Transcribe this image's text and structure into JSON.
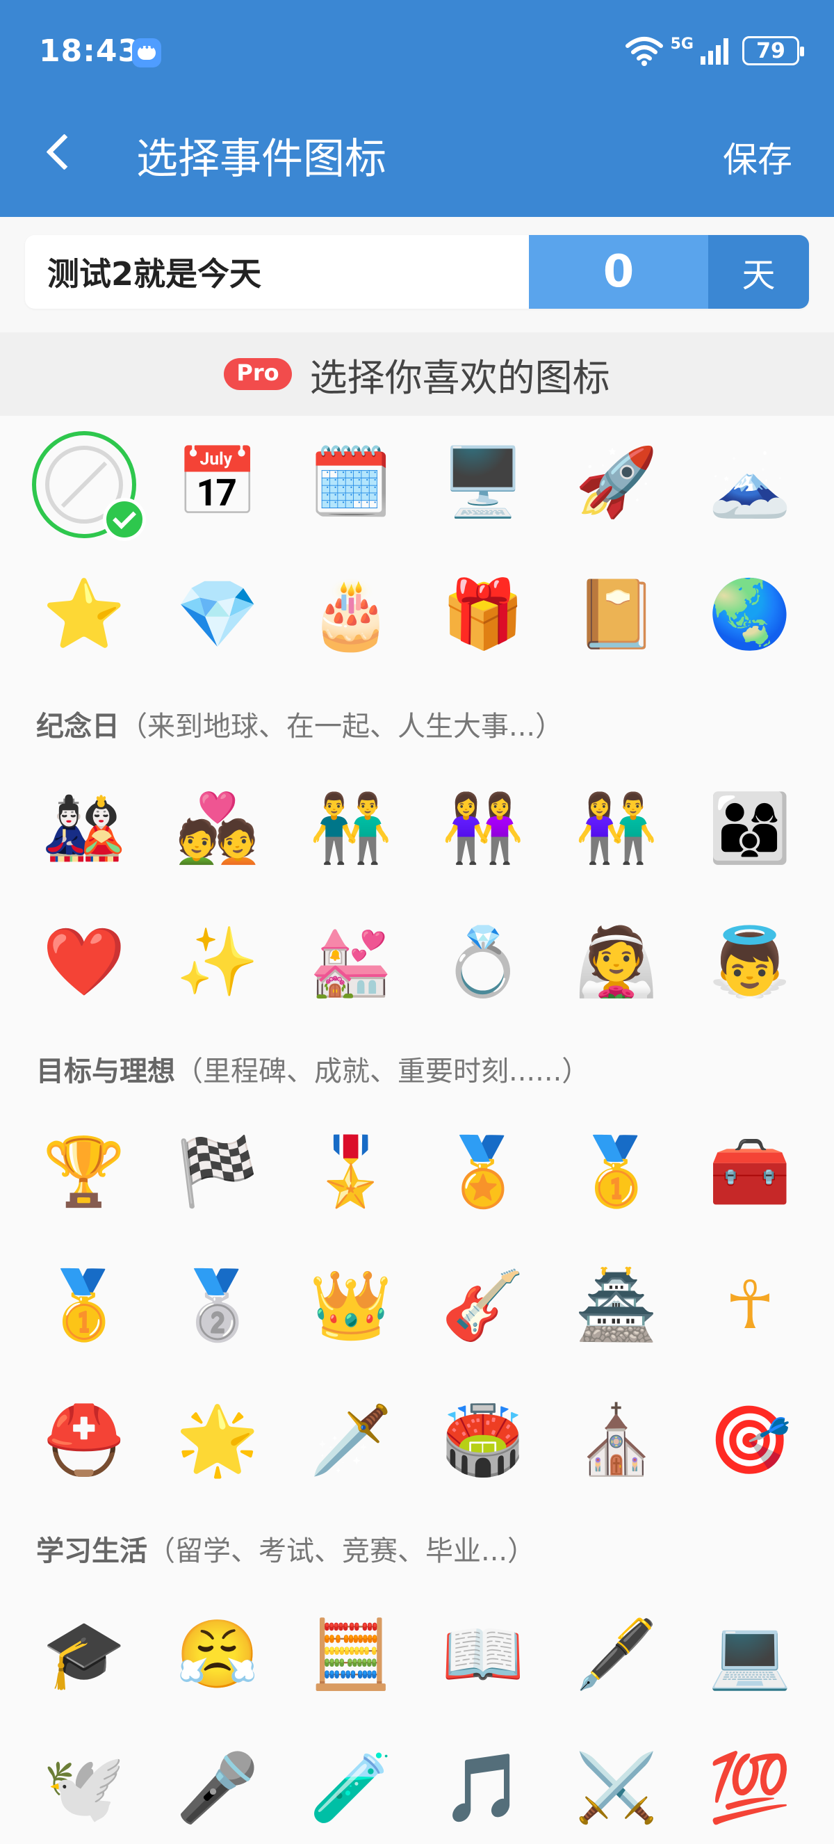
{
  "status_bar": {
    "time": "18:43",
    "network": "5G",
    "battery": "79"
  },
  "header": {
    "title": "选择事件图标",
    "save_label": "保存"
  },
  "event": {
    "name": "测试2就是今天",
    "days": "0",
    "unit": "天"
  },
  "pro": {
    "badge": "Pro",
    "text": "选择你喜欢的图标"
  },
  "sections": [
    {
      "bold": "",
      "hint": ""
    },
    {
      "bold": "纪念日",
      "hint": "（来到地球、在一起、人生大事...）"
    },
    {
      "bold": "目标与理想",
      "hint": "（里程碑、成就、重要时刻......）"
    },
    {
      "bold": "学习生活",
      "hint": "（留学、考试、竞赛、毕业...）"
    }
  ],
  "icons": {
    "general_row1": [
      "none",
      "📅",
      "🗓️",
      "🖥️",
      "🚀",
      "🗻"
    ],
    "general_row2": [
      "⭐",
      "💎",
      "🎂",
      "🎁",
      "📔",
      "🌏"
    ],
    "anniversary_row1": [
      "🎎",
      "💑",
      "👬",
      "👭",
      "👫",
      "👨‍👩‍👦"
    ],
    "anniversary_row2": [
      "❤️",
      "✨",
      "💒",
      "💍",
      "👰",
      "👼"
    ],
    "goals_row1": [
      "🏆",
      "🏁",
      "🎖️",
      "🏅",
      "🥇",
      "🧰"
    ],
    "goals_row2": [
      "🥇",
      "🥈",
      "👑",
      "🎸",
      "🏯",
      "☥"
    ],
    "goals_row3": [
      "⛑️",
      "🌟",
      "🗡️",
      "🏟️",
      "⛪",
      "🎯"
    ],
    "study_row1": [
      "🎓",
      "😤",
      "🧮",
      "📖",
      "🖋️",
      "💻"
    ],
    "study_row2": [
      "🕊️",
      "🎤",
      "🧪",
      "🎵",
      "⚔️",
      "💯"
    ]
  }
}
